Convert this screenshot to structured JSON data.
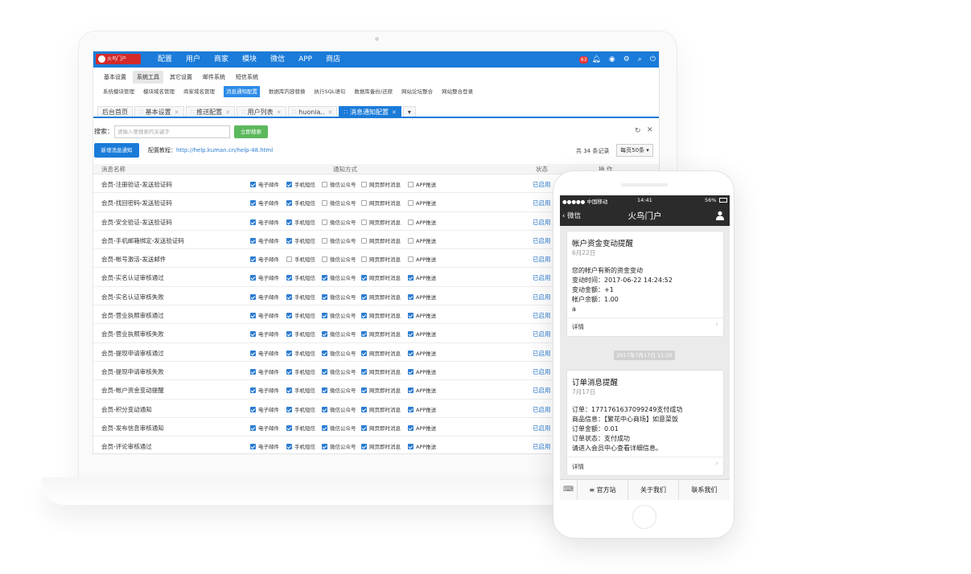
{
  "admin": {
    "logo_text": "火鸟门户",
    "main_nav": [
      "配置",
      "用户",
      "商家",
      "模块",
      "微信",
      "APP",
      "商店"
    ],
    "notification_count": "63",
    "sub_nav": [
      {
        "label": "基本设置",
        "active": false
      },
      {
        "label": "系统工具",
        "active": true
      },
      {
        "label": "其它设置",
        "active": false
      },
      {
        "label": "邮件系统",
        "active": false
      },
      {
        "label": "短信系统",
        "active": false
      }
    ],
    "tool_nav": [
      {
        "label": "系统模块管理",
        "active": false
      },
      {
        "label": "模块域名管理",
        "active": false
      },
      {
        "label": "商家域名管理",
        "active": false
      },
      {
        "label": "消息通知配置",
        "active": true
      },
      {
        "label": "数据库内容替换",
        "active": false
      },
      {
        "label": "执行SQL语句",
        "active": false
      },
      {
        "label": "数据库备份/还原",
        "active": false
      },
      {
        "label": "网站论坛整合",
        "active": false
      },
      {
        "label": "网站整合登录",
        "active": false
      }
    ],
    "tabs": [
      {
        "label": "后台首页",
        "active": false,
        "closable": false
      },
      {
        "label": "基本设置",
        "active": false,
        "closable": true
      },
      {
        "label": "推送配置",
        "active": false,
        "closable": true
      },
      {
        "label": "用户列表",
        "active": false,
        "closable": true
      },
      {
        "label": "huonia..",
        "active": false,
        "closable": true
      },
      {
        "label": "消息通知配置",
        "active": true,
        "closable": true
      }
    ],
    "search": {
      "label": "搜索：",
      "placeholder": "请输入要搜索的关键字",
      "button": "立即搜索"
    },
    "new_button": "新增消息通知",
    "config_label": "配置教程：",
    "config_link": "http://help.kuman.cn/help-48.html",
    "total": "共 34 条记录",
    "per_page": "每页50条",
    "table_headers": {
      "name": "消息名称",
      "method": "通知方式",
      "status": "状态",
      "action": "操 作"
    },
    "channel_labels": [
      "电子邮件",
      "手机短信",
      "微信公众号",
      "网页即时消息",
      "APP推送"
    ],
    "rows": [
      {
        "name": "会员-注册验证-发送验证码",
        "checks": [
          true,
          true,
          false,
          false,
          false
        ],
        "status": "已启用"
      },
      {
        "name": "会员-找回密码-发送验证码",
        "checks": [
          true,
          true,
          false,
          false,
          false
        ],
        "status": "已启用"
      },
      {
        "name": "会员-安全验证-发送验证码",
        "checks": [
          true,
          true,
          false,
          false,
          false
        ],
        "status": "已启用"
      },
      {
        "name": "会员-手机邮箱绑定-发送验证码",
        "checks": [
          true,
          true,
          false,
          false,
          false
        ],
        "status": "已启用"
      },
      {
        "name": "会员-帐号激活-发送邮件",
        "checks": [
          true,
          false,
          false,
          false,
          false
        ],
        "status": "已启用"
      },
      {
        "name": "会员-实名认证审核通过",
        "checks": [
          true,
          true,
          true,
          true,
          true
        ],
        "status": "已启用"
      },
      {
        "name": "会员-实名认证审核失败",
        "checks": [
          true,
          true,
          true,
          true,
          true
        ],
        "status": "已启用"
      },
      {
        "name": "会员-营业执照审核通过",
        "checks": [
          true,
          true,
          true,
          true,
          true
        ],
        "status": "已启用"
      },
      {
        "name": "会员-营业执照审核失败",
        "checks": [
          true,
          true,
          true,
          true,
          true
        ],
        "status": "已启用"
      },
      {
        "name": "会员-提现申请审核通过",
        "checks": [
          true,
          true,
          true,
          true,
          true
        ],
        "status": "已启用"
      },
      {
        "name": "会员-提现申请审核失败",
        "checks": [
          true,
          true,
          true,
          true,
          true
        ],
        "status": "已启用"
      },
      {
        "name": "会员-帐户资金变动提醒",
        "checks": [
          true,
          true,
          true,
          true,
          true
        ],
        "status": "已启用"
      },
      {
        "name": "会员-积分变动通知",
        "checks": [
          true,
          true,
          true,
          true,
          true
        ],
        "status": "已启用"
      },
      {
        "name": "会员-发布信息审核通知",
        "checks": [
          true,
          true,
          true,
          true,
          true
        ],
        "status": "已启用"
      },
      {
        "name": "会员-评论审核通过",
        "checks": [
          true,
          true,
          true,
          true,
          true
        ],
        "status": "已启用"
      }
    ]
  },
  "phone": {
    "carrier": "●●●●● 中国移动",
    "time": "14:41",
    "battery": "56%",
    "back_label": "微信",
    "title": "火鸟门户",
    "card1": {
      "title": "帐户资金变动提醒",
      "date": "6月22日",
      "lines": [
        "您的帐户有新的资金变动",
        "变动时间：2017-06-22 14:24:52",
        "变动金额：+1",
        "帐户余额：1.00",
        "a"
      ],
      "detail": "详情"
    },
    "timestamp": "2017年7月17日 11:20",
    "card2": {
      "title": "订单消息提醒",
      "date": "7月17日",
      "lines": [
        "订单：1771761637099249支付成功",
        "商品信息：【繁花中心商场】如意菜饭",
        "订单金额：0.01",
        "订单状态：支付成功",
        "请进入会员中心查看详细信息。"
      ],
      "detail": "详情"
    },
    "menu": [
      "官方站",
      "关于我们",
      "联系我们"
    ]
  }
}
